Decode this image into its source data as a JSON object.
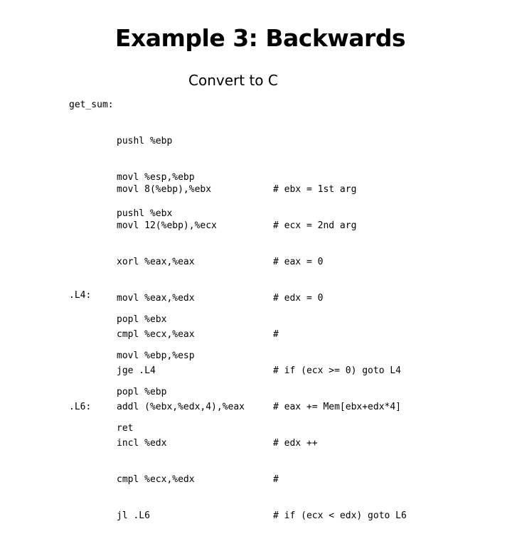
{
  "slide": {
    "title": "Example 3: Backwards",
    "subtitle": "Convert to C"
  },
  "code": {
    "function_label": "get_sum:",
    "prologue": [
      "pushl %ebp",
      "movl %esp,%ebp",
      "pushl %ebx"
    ],
    "body": [
      {
        "label": "",
        "instr": "movl 8(%ebp),%ebx",
        "comment": "# ebx = 1st arg"
      },
      {
        "label": "",
        "instr": "movl 12(%ebp),%ecx",
        "comment": "# ecx = 2nd arg"
      },
      {
        "label": "",
        "instr": "xorl %eax,%eax",
        "comment": "# eax = 0"
      },
      {
        "label": "",
        "instr": "movl %eax,%edx",
        "comment": "# edx = 0"
      },
      {
        "label": "",
        "instr": "cmpl %ecx,%eax",
        "comment": "#"
      },
      {
        "label": "",
        "instr": "jge .L4",
        "comment": "# if (ecx >= 0) goto L4"
      },
      {
        "label": ".L6:",
        "instr": "addl (%ebx,%edx,4),%eax",
        "comment": "# eax += Mem[ebx+edx*4]"
      },
      {
        "label": "",
        "instr": "incl %edx",
        "comment": "# edx ++"
      },
      {
        "label": "",
        "instr": "cmpl %ecx,%edx",
        "comment": "#"
      },
      {
        "label": "",
        "instr": "jl .L6",
        "comment": "# if (ecx < edx) goto L6"
      }
    ],
    "epilogue_label": ".L4:",
    "epilogue": [
      "popl %ebx",
      "movl %ebp,%esp",
      "popl %ebp",
      "ret"
    ]
  }
}
